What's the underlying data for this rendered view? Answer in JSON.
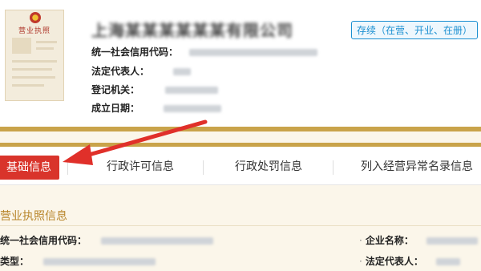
{
  "company": {
    "license_title": "营业执照",
    "name": "上海某某某某某某有限公司",
    "status": "存续（在营、开业、在册）",
    "fields": [
      {
        "label": "统一社会信用代码："
      },
      {
        "label": "法定代表人："
      },
      {
        "label": "登记机关："
      },
      {
        "label": "成立日期："
      }
    ]
  },
  "tabs": [
    {
      "label": "基础信息",
      "active": true
    },
    {
      "label": "行政许可信息",
      "active": false
    },
    {
      "label": "行政处罚信息",
      "active": false
    },
    {
      "label": "列入经营异常名录信息",
      "active": false
    }
  ],
  "section": {
    "title": "营业执照信息",
    "left_fields": [
      {
        "label": "统一社会信用代码："
      },
      {
        "label": "类型："
      }
    ],
    "right_fields": [
      {
        "label": "企业名称："
      },
      {
        "label": "法定代表人："
      }
    ]
  },
  "colors": {
    "gold": "#c9a34a",
    "active_tab": "#d9342b",
    "status_blue": "#1a8fd1",
    "arrow_red": "#e0302a"
  }
}
